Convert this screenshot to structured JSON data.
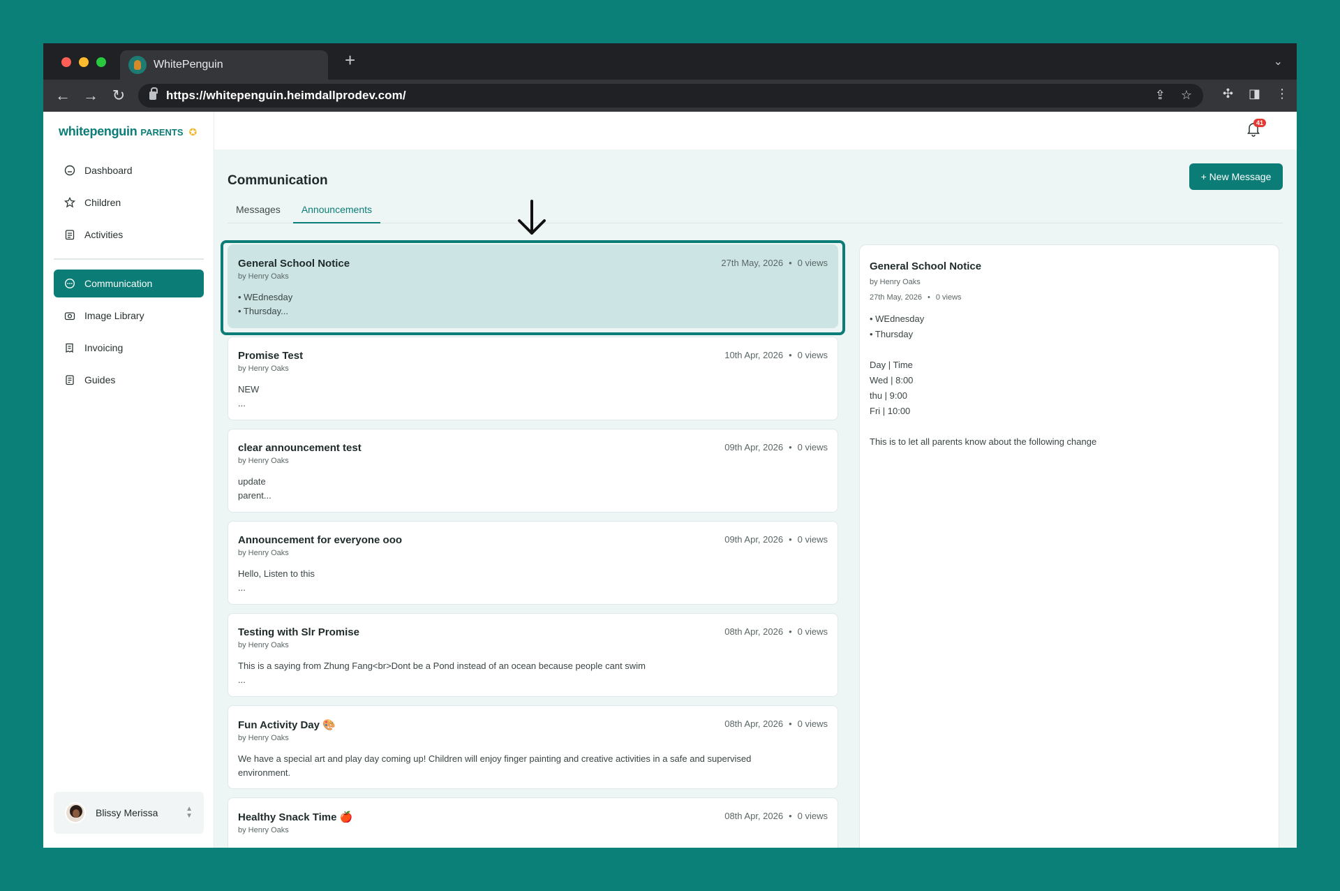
{
  "browser": {
    "tab_title": "WhitePenguin",
    "url": "https://whitepenguin.heimdallprodev.com/",
    "new_tab": "+"
  },
  "brand": {
    "logo_main": "whitepenguin",
    "logo_sub": "PARENTS",
    "accent": "#0b7d76"
  },
  "sidebar": {
    "items": [
      {
        "label": "Dashboard",
        "icon": "dashboard-icon"
      },
      {
        "label": "Children",
        "icon": "children-icon"
      },
      {
        "label": "Activities",
        "icon": "activities-icon"
      },
      {
        "label": "Communication",
        "icon": "chat-icon",
        "active": true
      },
      {
        "label": "Image Library",
        "icon": "camera-icon"
      },
      {
        "label": "Invoicing",
        "icon": "invoice-icon"
      },
      {
        "label": "Guides",
        "icon": "guides-icon"
      }
    ],
    "user_name": "Blissy Merissa"
  },
  "header": {
    "notification_count": "41"
  },
  "main": {
    "title": "Communication",
    "new_message_label": "+ New Message",
    "tabs": [
      {
        "label": "Messages"
      },
      {
        "label": "Announcements",
        "active": true
      }
    ]
  },
  "announcements": [
    {
      "title": "General School Notice",
      "by": "by Henry Oaks",
      "date": "27th May, 2026",
      "views": "0 views",
      "body": [
        "• WEdnesday",
        "• Thursday..."
      ]
    },
    {
      "title": "Promise Test",
      "by": "by Henry Oaks",
      "date": "10th Apr, 2026",
      "views": "0 views",
      "body": [
        "NEW",
        "..."
      ]
    },
    {
      "title": "clear announcement test",
      "by": "by Henry Oaks",
      "date": "09th Apr, 2026",
      "views": "0 views",
      "body": [
        "update",
        "parent..."
      ]
    },
    {
      "title": "Announcement for everyone ooo",
      "by": "by Henry Oaks",
      "date": "09th Apr, 2026",
      "views": "0 views",
      "body": [
        "Hello, Listen to this",
        "..."
      ]
    },
    {
      "title": "Testing with Slr Promise",
      "by": "by Henry Oaks",
      "date": "08th Apr, 2026",
      "views": "0 views",
      "body": [
        "This is a saying from Zhung Fang<br>Dont be a Pond instead of an ocean because people cant swim",
        "..."
      ]
    },
    {
      "title": "Fun Activity Day 🎨",
      "by": "by Henry Oaks",
      "date": "08th Apr, 2026",
      "views": "0 views",
      "body": [
        "We have a special art and play day coming up! Children will enjoy finger painting and creative activities in a safe and supervised",
        "environment."
      ]
    },
    {
      "title": "Healthy Snack Time 🍎",
      "by": "by Henry Oaks",
      "date": "08th Apr, 2026",
      "views": "0 views",
      "body": []
    }
  ],
  "detail": {
    "title": "General School Notice",
    "by": "by Henry Oaks",
    "date": "27th May, 2026",
    "views": "0 views",
    "bullets": [
      "• WEdnesday",
      "• Thursday"
    ],
    "schedule": [
      "Day | Time",
      "Wed | 8:00",
      "thu | 9:00",
      "Fri | 10:00"
    ],
    "note": "This is to let all parents know about the following change"
  }
}
